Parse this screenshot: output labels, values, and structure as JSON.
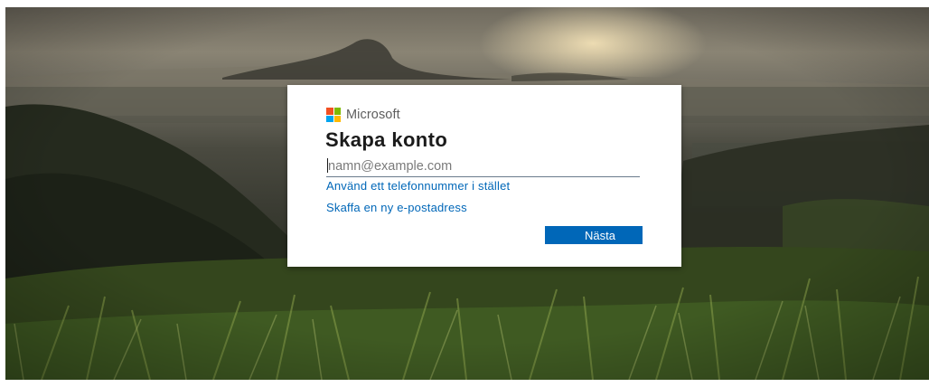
{
  "background": {
    "description_colors": {
      "sky": "#8a8474",
      "sun_glow": "#ffecbe",
      "hills": "#2f3227",
      "grass": "#3f5a22",
      "grass_light": "#8aa04a"
    }
  },
  "dialog": {
    "brand": {
      "name": "Microsoft",
      "logo_icon": "microsoft-logo-icon",
      "logo_colors": [
        "#f25022",
        "#7fba00",
        "#00a4ef",
        "#ffb900"
      ]
    },
    "title": "Skapa konto",
    "email_input": {
      "value": "",
      "placeholder": "namn@example.com"
    },
    "links": {
      "use_phone": "Använd ett telefonnummer i stället",
      "new_email": "Skaffa en ny e-postadress"
    },
    "next_button": {
      "label": "Nästa",
      "color": "#0067b8"
    },
    "accent_color": "#0067b8"
  }
}
